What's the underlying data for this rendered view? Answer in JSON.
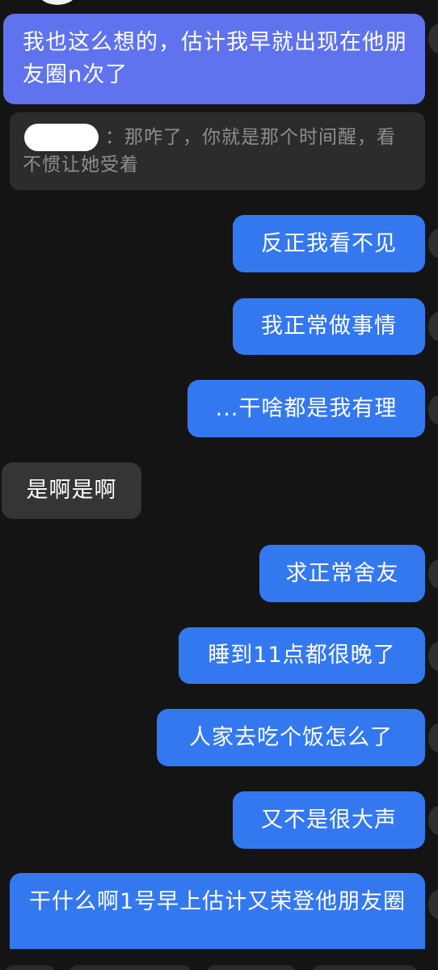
{
  "chat": {
    "messages": [
      {
        "side": "sent",
        "text": "我也这么想的，估计我早就出现在他朋友圈n次了"
      },
      {
        "side": "quote",
        "text": "：那咋了，你就是那个时间醒，看不惯让她受着"
      },
      {
        "side": "sent",
        "text": "反正我看不见"
      },
      {
        "side": "sent",
        "text": "我正常做事情"
      },
      {
        "side": "sent",
        "text": "...干啥都是我有理"
      },
      {
        "side": "received",
        "text": "是啊是啊"
      },
      {
        "side": "sent",
        "text": "求正常舍友"
      },
      {
        "side": "sent",
        "text": "睡到11点都很晚了"
      },
      {
        "side": "sent",
        "text": "人家去吃个饭怎么了"
      },
      {
        "side": "sent",
        "text": "又不是很大声"
      },
      {
        "side": "sent",
        "text": "干什么啊1号早上估计又荣登他朋友圈"
      }
    ]
  },
  "colors": {
    "background": "#141414",
    "sent_bubble": "#3478f0",
    "sent_bubble_first": "#5f73ee",
    "received_bubble": "#353535",
    "quote_box": "#2c2c2c",
    "quote_text": "#8e8e8e"
  }
}
